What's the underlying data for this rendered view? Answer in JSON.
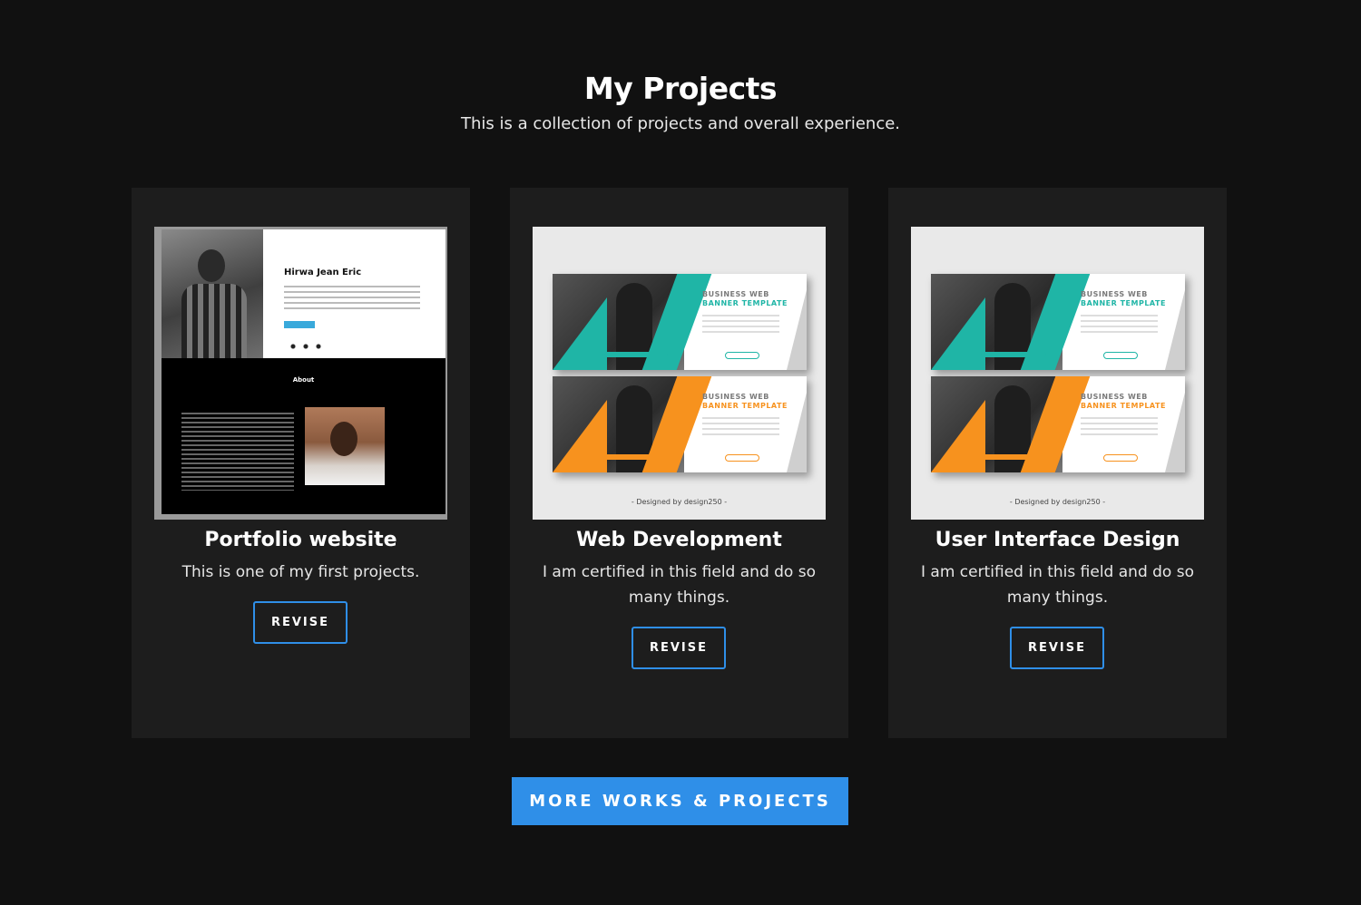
{
  "header": {
    "title": "My Projects",
    "subtitle": "This is a collection of projects and overall experience."
  },
  "projects": [
    {
      "title": "Portfolio website",
      "description": "This is one of my first projects.",
      "button": "REVISE",
      "thumb": {
        "name": "Hirwa Jean Eric",
        "section": "About"
      }
    },
    {
      "title": "Web Development",
      "description": "I am certified in this field and do so many things.",
      "button": "REVISE",
      "thumb": {
        "headline_1": "BUSINESS WEB",
        "headline_2": "BANNER TEMPLATE",
        "credit": "- Designed by design250 -"
      }
    },
    {
      "title": "User Interface Design",
      "description": "I am certified in this field and do so many things.",
      "button": "REVISE",
      "thumb": {
        "headline_1": "BUSINESS WEB",
        "headline_2": "BANNER TEMPLATE",
        "credit": "- Designed by design250 -"
      }
    }
  ],
  "more_button": "MORE WORKS & PROJECTS",
  "colors": {
    "background": "#111111",
    "card": "#1d1d1d",
    "accent": "#2f8fe8",
    "teal": "#1fb5a6",
    "orange": "#f7921e"
  }
}
